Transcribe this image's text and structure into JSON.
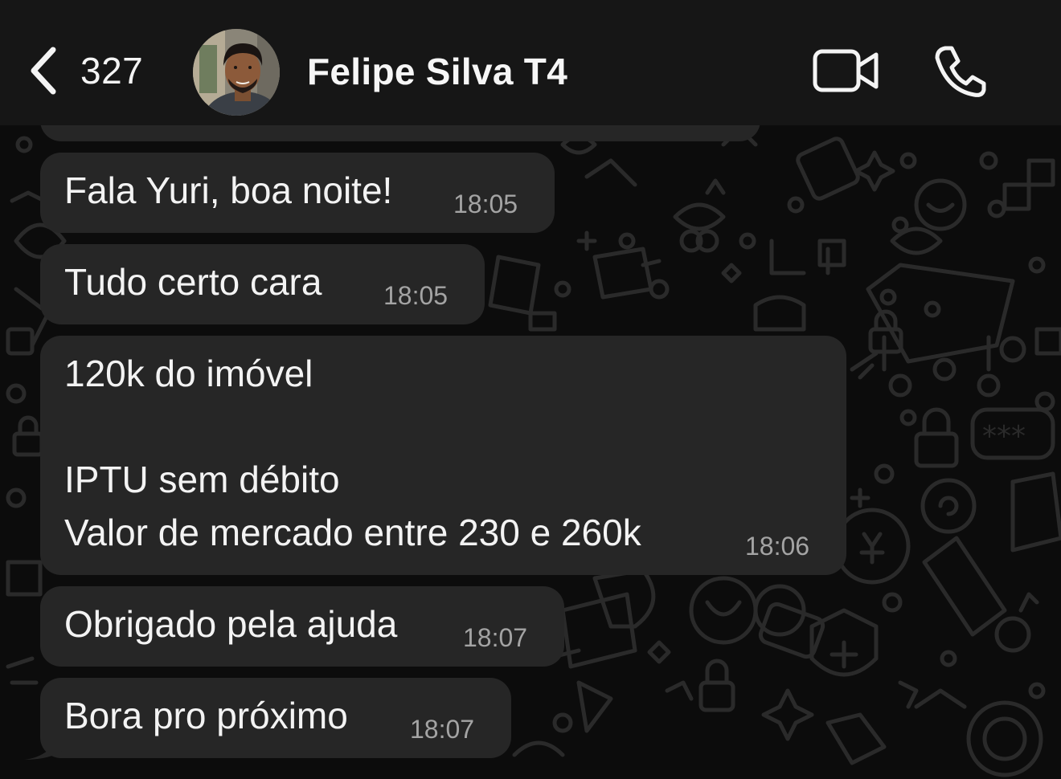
{
  "header": {
    "back_count": "327",
    "contact_name": "Felipe Silva T4",
    "icons": {
      "back": "chevron-left-icon",
      "avatar": "contact-avatar",
      "video": "video-camera-icon",
      "call": "phone-icon"
    }
  },
  "messages": [
    {
      "text": "Fala Yuri, boa noite!",
      "time": "18:05"
    },
    {
      "text": "Tudo certo cara",
      "time": "18:05"
    },
    {
      "lines": [
        "120k do imóvel",
        "",
        "IPTU sem débito",
        "Valor de mercado entre 230 e 260k"
      ],
      "time": "18:06"
    },
    {
      "text": "Obrigado pela ajuda",
      "time": "18:07"
    },
    {
      "text": "Bora pro próximo",
      "time": "18:07"
    }
  ],
  "colors": {
    "background": "#0c0c0c",
    "header": "#161616",
    "bubble": "#262626",
    "text": "#f3f3f3",
    "timestamp": "#a4a4a4"
  }
}
